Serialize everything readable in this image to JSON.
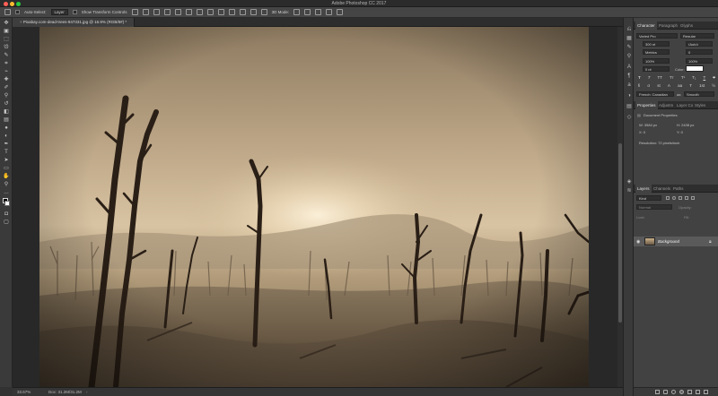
{
  "app": {
    "title": "Adobe Photoshop CC 2017"
  },
  "options_bar": {
    "auto_select_label": "Auto-Select:",
    "auto_select_value": "Layer",
    "show_transform_label": "Show Transform Controls",
    "mode_3d_label": "3D Mode:"
  },
  "document": {
    "tab_label": "Pixabay.com-dead-trees-947331.jpg @ 16.9% (RGB/8#) *"
  },
  "status": {
    "zoom": "33.67%",
    "doc": "Doc: 31.2M/31.2M"
  },
  "panels": {
    "character": {
      "tabs": [
        "Character",
        "Paragraph",
        "Glyphs"
      ],
      "font_family": "Varied Pro",
      "font_style": "Regular",
      "font_size": "300 pt",
      "leading": "(Auto)",
      "kerning": "Metrics",
      "tracking": "0",
      "vscale": "100%",
      "hscale": "100%",
      "baseline": "0 pt",
      "color_label": "Color:",
      "language": "French: Canadian",
      "anti_alias": "Smooth",
      "aa_prefix": "aa",
      "style_buttons": [
        "T",
        "T",
        "TT",
        "Tт",
        "T¹",
        "T₁",
        "T",
        "T"
      ],
      "opentype_buttons": [
        "fi",
        "σ",
        "st",
        "A",
        "aa",
        "T",
        "1st",
        "½"
      ]
    },
    "properties": {
      "tabs": [
        "Properties",
        "Adjustm",
        "Layer Co",
        "Styles"
      ],
      "section": "Document Properties",
      "w": "W: 3584 px",
      "h": "H: 2438 px",
      "x": "X: 0",
      "y": "Y: 0",
      "resolution": "Resolution: 72 pixels/inch"
    },
    "layers": {
      "tabs": [
        "Layers",
        "Channels",
        "Paths"
      ],
      "kind": "Kind",
      "mode": "Normal",
      "opacity_label": "Opacity:",
      "lock_label": "Lock:",
      "fill_label": "Fill:",
      "layer_name": "Background"
    }
  },
  "icons": {
    "toolbar": [
      "move-icon",
      "artboard-icon",
      "marquee-icon",
      "lasso-icon",
      "quick-select-icon",
      "crop-icon",
      "eyedropper-icon",
      "healing-brush-icon",
      "brush-icon",
      "clone-stamp-icon",
      "history-brush-icon",
      "eraser-icon",
      "gradient-icon",
      "blur-icon",
      "dodge-icon",
      "pen-icon",
      "type-icon",
      "path-select-icon",
      "rectangle-icon",
      "hand-icon",
      "zoom-icon",
      "more-tools-icon",
      "color-swatch-icon",
      "quick-mask-icon",
      "screen-mode-icon"
    ],
    "strip": [
      "history-icon",
      "properties-icon",
      "brushes-icon",
      "clone-source-icon",
      "character-icon",
      "paragraph-icon",
      "glyphs-icon",
      "adjustments-icon",
      "libraries-icon",
      "3d-icon",
      "layers-icon",
      "channels-icon"
    ]
  },
  "colors": {
    "accent": "#4a7bd0",
    "background": "#323232",
    "panel": "#424242"
  }
}
